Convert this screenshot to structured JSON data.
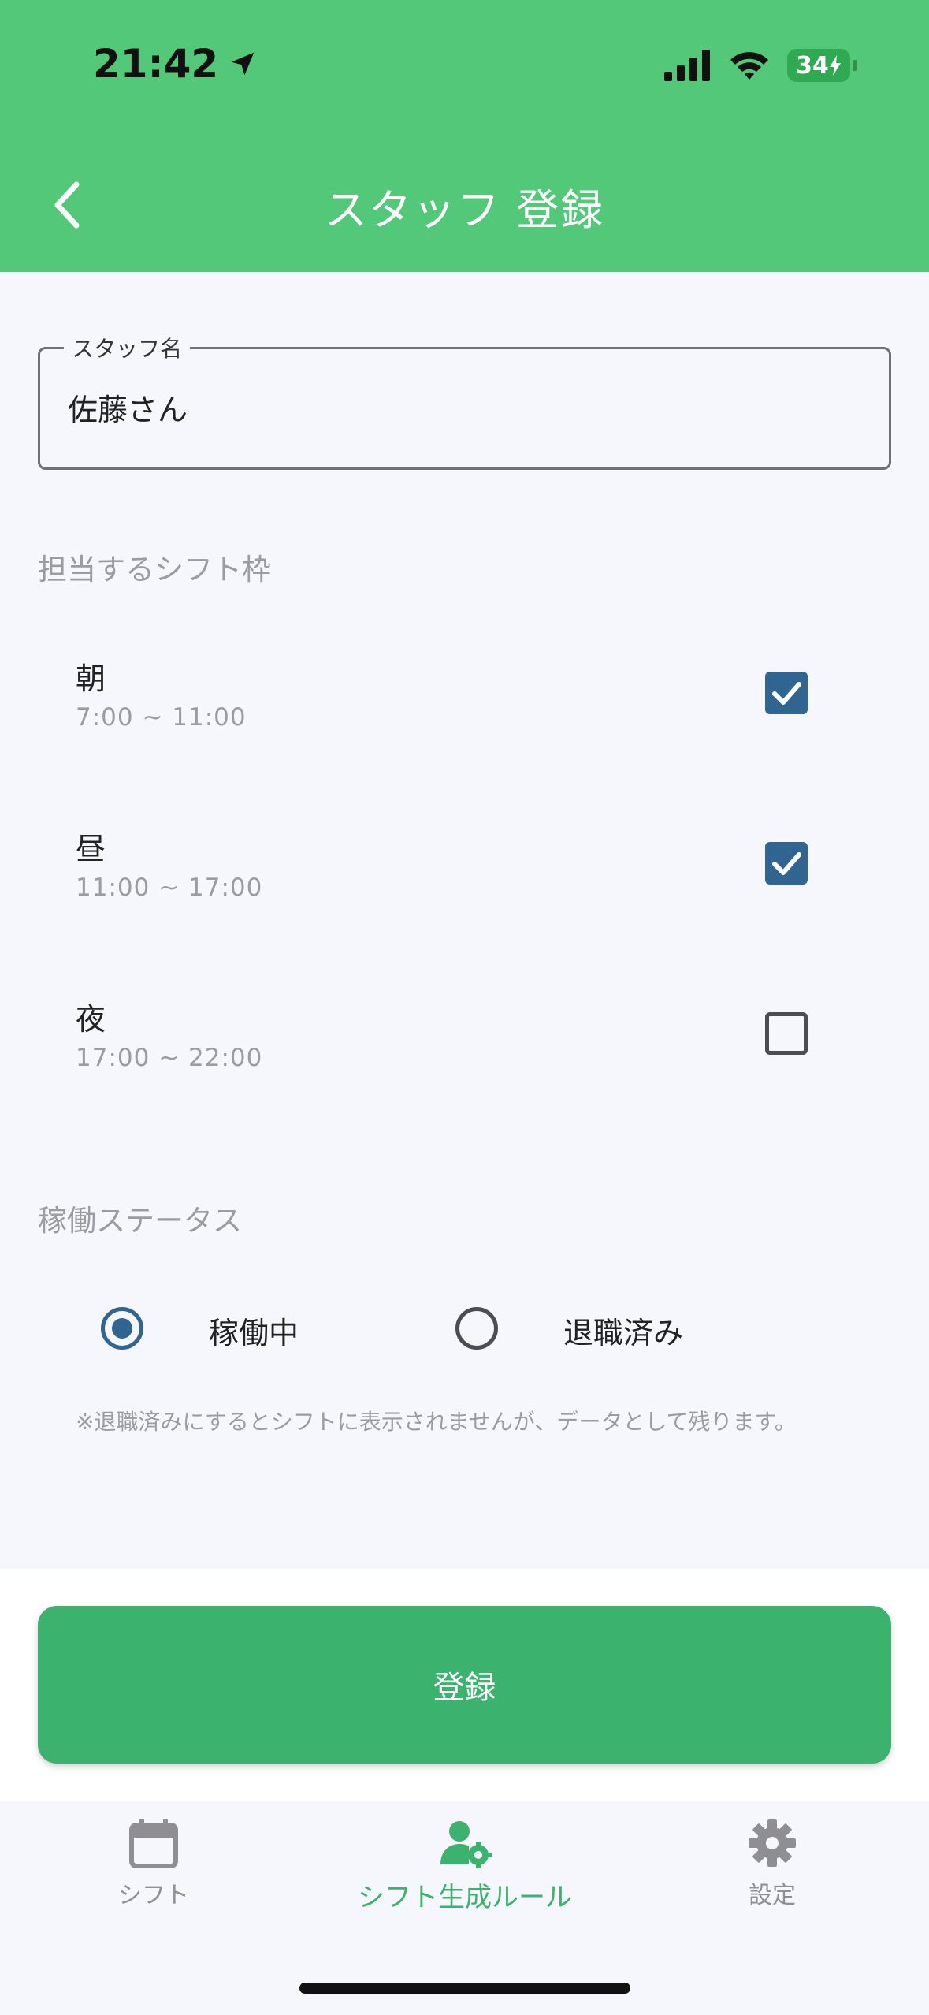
{
  "status_bar": {
    "time": "21:42",
    "battery": "34",
    "icons": [
      "location-arrow-icon",
      "cellular-signal-icon",
      "wifi-icon",
      "battery-charging-icon"
    ]
  },
  "header": {
    "title": "スタッフ 登録",
    "back_icon": "chevron-left-icon",
    "color": "#53c878"
  },
  "form": {
    "name_field": {
      "label": "スタッフ名",
      "value": "佐藤さん"
    },
    "shift_section_label": "担当するシフト枠",
    "shifts": [
      {
        "name": "朝",
        "time": "7:00 ~ 11:00",
        "checked": true
      },
      {
        "name": "昼",
        "time": "11:00 ~ 17:00",
        "checked": true
      },
      {
        "name": "夜",
        "time": "17:00 ~ 22:00",
        "checked": false
      }
    ],
    "status_section_label": "稼働ステータス",
    "status_options": [
      {
        "label": "稼働中",
        "selected": true
      },
      {
        "label": "退職済み",
        "selected": false
      }
    ],
    "note": "※退職済みにするとシフトに表示されませんが、データとして残ります。",
    "submit_label": "登録",
    "accent_color": "#2f6590",
    "button_color": "#3bb36e"
  },
  "tabbar": {
    "tabs": [
      {
        "label": "シフト",
        "icon": "calendar-icon",
        "active": false
      },
      {
        "label": "シフト生成ルール",
        "icon": "user-gear-icon",
        "active": true
      },
      {
        "label": "設定",
        "icon": "gear-icon",
        "active": false
      }
    ],
    "active_color": "#3bb36e",
    "inactive_color": "#8e8e93"
  }
}
